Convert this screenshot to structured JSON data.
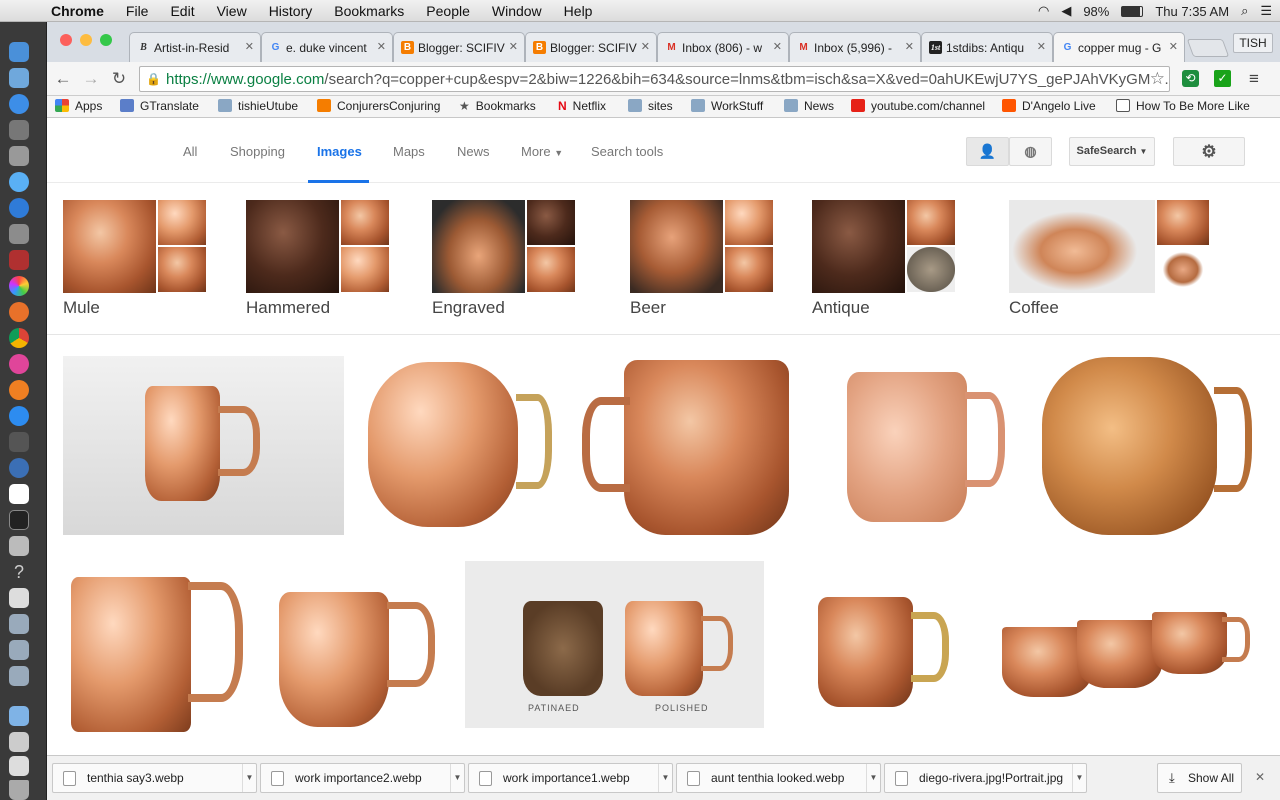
{
  "menubar": {
    "items": [
      "Chrome",
      "File",
      "Edit",
      "View",
      "History",
      "Bookmarks",
      "People",
      "Window",
      "Help"
    ],
    "battery": "98%",
    "clock": "Thu 7:35 AM"
  },
  "tabs": [
    {
      "icon": "B",
      "label": "Artist-in-Resid"
    },
    {
      "icon": "G",
      "label": "e. duke vincent"
    },
    {
      "icon": "B",
      "label": "Blogger: SCIFIV"
    },
    {
      "icon": "B",
      "label": "Blogger: SCIFIV"
    },
    {
      "icon": "M",
      "label": "Inbox (806) - w"
    },
    {
      "icon": "M",
      "label": "Inbox (5,996) -"
    },
    {
      "icon": "1st",
      "label": "1stdibs: Antiqu"
    },
    {
      "icon": "G",
      "label": "copper mug - G"
    }
  ],
  "profile": "TISH",
  "address": {
    "domain": "https://www.google.com",
    "path": "/search?q=copper+cup&espv=2&biw=1226&bih=634&source=lnms&tbm=isch&sa=X&ved=0ahUKEwjU7YS_gePJAhVKyGMK..."
  },
  "bookmarks": [
    "Apps",
    "GTranslate",
    "tishieUtube",
    "ConjurersConjuring",
    "Bookmarks",
    "Netflix",
    "sites",
    "WorkStuff",
    "News",
    "youtube.com/channel",
    "D'Angelo Live",
    "How To Be More Like"
  ],
  "search_tabs": [
    "All",
    "Shopping",
    "Images",
    "Maps",
    "News",
    "More",
    "Search tools"
  ],
  "safesearch": "SafeSearch",
  "related": [
    "Mule",
    "Hammered",
    "Engraved",
    "Beer",
    "Antique",
    "Coffee"
  ],
  "image_captions": {
    "patinaed": "PATINAED",
    "polished": "POLISHED"
  },
  "downloads": [
    "tenthia say3.webp",
    "work importance2.webp",
    "work importance1.webp",
    "aunt tenthia looked.webp",
    "diego-rivera.jpg!Portrait.jpg"
  ],
  "show_all": "Show All"
}
